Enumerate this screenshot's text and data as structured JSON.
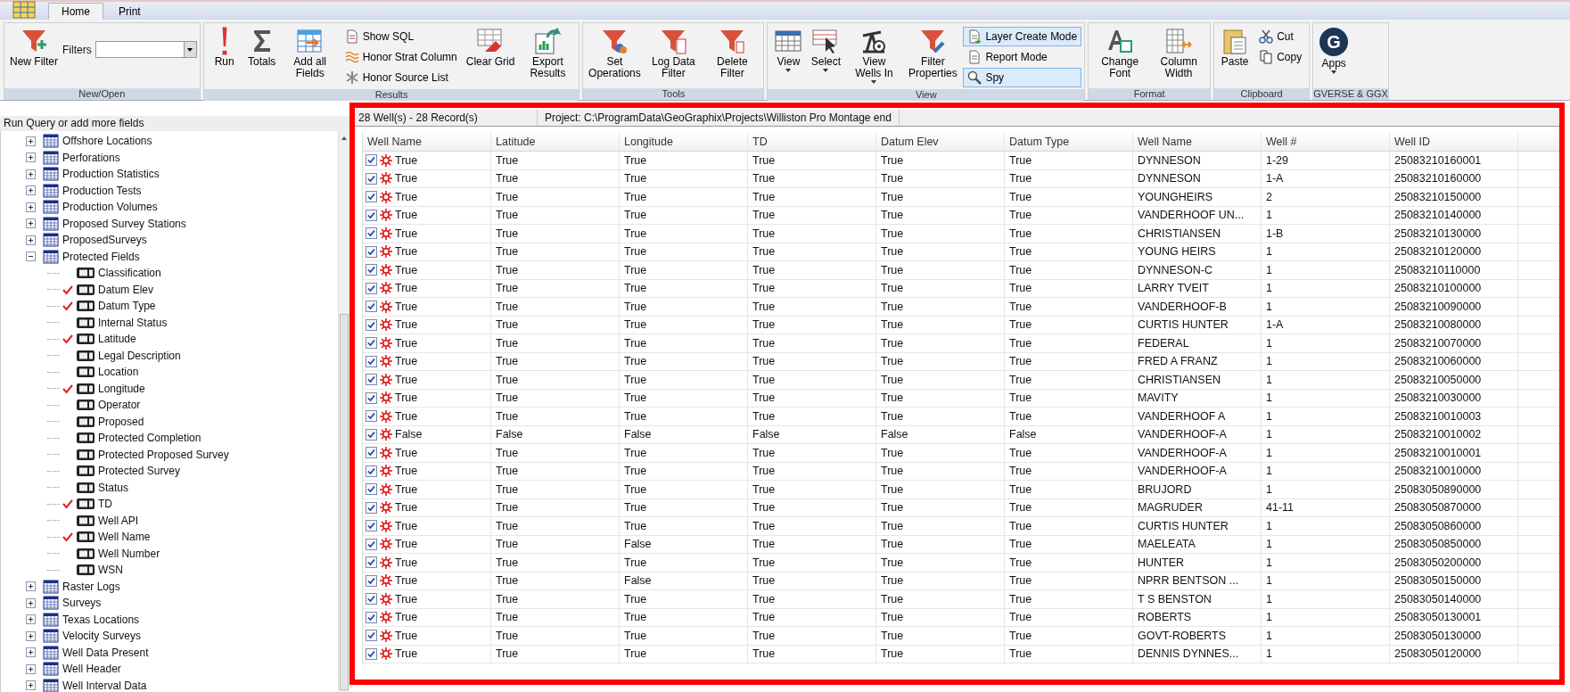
{
  "ribbon": {
    "tabs": [
      {
        "label": "Home",
        "selected": true
      },
      {
        "label": "Print",
        "selected": false
      }
    ],
    "groups": [
      {
        "label": "New/Open",
        "items": [
          {
            "kind": "large",
            "label": "New Filter",
            "dropdown": false
          },
          {
            "kind": "combo",
            "label": "Filters"
          }
        ]
      },
      {
        "label": "Results",
        "items": [
          {
            "kind": "large",
            "label": "Run",
            "dropdown": false
          },
          {
            "kind": "large",
            "label": "Totals",
            "dropdown": false
          },
          {
            "kind": "large",
            "label": "Add all Fields",
            "dropdown": false
          },
          {
            "kind": "stack",
            "items": [
              {
                "label": "Show SQL",
                "selected": false
              },
              {
                "label": "Honor Strat Column",
                "selected": false
              },
              {
                "label": "Honor Source List",
                "selected": false
              }
            ]
          },
          {
            "kind": "large",
            "label": "Clear Grid",
            "dropdown": false
          },
          {
            "kind": "large",
            "label": "Export Results",
            "dropdown": false
          }
        ]
      },
      {
        "label": "Tools",
        "items": [
          {
            "kind": "large",
            "label": "Set Operations",
            "dropdown": false
          },
          {
            "kind": "large",
            "label": "Log Data Filter",
            "dropdown": false
          },
          {
            "kind": "large",
            "label": "Delete Filter",
            "dropdown": false
          }
        ]
      },
      {
        "label": "View",
        "items": [
          {
            "kind": "large",
            "label": "View",
            "dropdown": true
          },
          {
            "kind": "large",
            "label": "Select",
            "dropdown": true
          },
          {
            "kind": "large",
            "label": "View Wells In",
            "dropdown": true
          },
          {
            "kind": "large",
            "label": "Filter Properties",
            "dropdown": false
          },
          {
            "kind": "stack",
            "items": [
              {
                "label": "Layer Create Mode",
                "selected": true
              },
              {
                "label": "Report Mode",
                "selected": false
              },
              {
                "label": "Spy",
                "selected": true
              }
            ]
          }
        ]
      },
      {
        "label": "Format",
        "items": [
          {
            "kind": "large",
            "label": "Change Font",
            "dropdown": false
          },
          {
            "kind": "large",
            "label": "Column Width",
            "dropdown": false
          }
        ]
      },
      {
        "label": "Clipboard",
        "items": [
          {
            "kind": "large",
            "label": "Paste",
            "dropdown": false
          },
          {
            "kind": "stack",
            "items": [
              {
                "label": "Cut",
                "selected": false
              },
              {
                "label": "Copy",
                "selected": false
              }
            ]
          }
        ]
      },
      {
        "label": "GVERSE & GGX",
        "items": [
          {
            "kind": "logo",
            "logo_letter": "G",
            "label": "Apps",
            "dropdown": true
          }
        ]
      }
    ]
  },
  "query_panel": {
    "header": "Run Query or add more fields",
    "tree": [
      {
        "label": "Offshore Locations",
        "expanded": false
      },
      {
        "label": "Perforations",
        "expanded": false
      },
      {
        "label": "Production Statistics",
        "expanded": false
      },
      {
        "label": "Production Tests",
        "expanded": false
      },
      {
        "label": "Production Volumes",
        "expanded": false
      },
      {
        "label": "Proposed Survey Stations",
        "expanded": false
      },
      {
        "label": "ProposedSurveys",
        "expanded": false
      },
      {
        "label": "Protected Fields",
        "expanded": true,
        "children": [
          {
            "label": "Classification",
            "checked": false
          },
          {
            "label": "Datum Elev",
            "checked": true
          },
          {
            "label": "Datum Type",
            "checked": true
          },
          {
            "label": "Internal Status",
            "checked": false
          },
          {
            "label": "Latitude",
            "checked": true
          },
          {
            "label": "Legal Description",
            "checked": false
          },
          {
            "label": "Location",
            "checked": false
          },
          {
            "label": "Longitude",
            "checked": true
          },
          {
            "label": "Operator",
            "checked": false
          },
          {
            "label": "Proposed",
            "checked": false
          },
          {
            "label": "Protected Completion",
            "checked": false
          },
          {
            "label": "Protected Proposed Survey",
            "checked": false
          },
          {
            "label": "Protected Survey",
            "checked": false
          },
          {
            "label": "Status",
            "checked": false
          },
          {
            "label": "TD",
            "checked": true
          },
          {
            "label": "Well API",
            "checked": false
          },
          {
            "label": "Well Name",
            "checked": true
          },
          {
            "label": "Well Number",
            "checked": false
          },
          {
            "label": "WSN",
            "checked": false
          }
        ]
      },
      {
        "label": "Raster Logs",
        "expanded": false
      },
      {
        "label": "Surveys",
        "expanded": false
      },
      {
        "label": "Texas Locations",
        "expanded": false
      },
      {
        "label": "Velocity Surveys",
        "expanded": false
      },
      {
        "label": "Well Data Present",
        "expanded": false
      },
      {
        "label": "Well Header",
        "expanded": false
      },
      {
        "label": "Well Interval Data",
        "expanded": false
      }
    ]
  },
  "results": {
    "record_count": "28 Well(s) - 28 Record(s)",
    "project": "Project:  C:\\ProgramData\\GeoGraphix\\Projects\\Williston Pro Montage end",
    "columns": [
      "Well Name",
      "Latitude",
      "Longitude",
      "TD",
      "Datum Elev",
      "Datum Type",
      "Well Name",
      "Well #",
      "Well ID"
    ],
    "rows": [
      {
        "checked": true,
        "cells": [
          "True",
          "True",
          "True",
          "True",
          "True",
          "True",
          "DYNNESON",
          "1-29",
          "25083210160001"
        ]
      },
      {
        "checked": true,
        "cells": [
          "True",
          "True",
          "True",
          "True",
          "True",
          "True",
          "DYNNESON",
          "1-A",
          "25083210160000"
        ]
      },
      {
        "checked": true,
        "cells": [
          "True",
          "True",
          "True",
          "True",
          "True",
          "True",
          "YOUNGHEIRS",
          "2",
          "25083210150000"
        ]
      },
      {
        "checked": true,
        "cells": [
          "True",
          "True",
          "True",
          "True",
          "True",
          "True",
          "VANDERHOOF UN...",
          "1",
          "25083210140000"
        ]
      },
      {
        "checked": true,
        "cells": [
          "True",
          "True",
          "True",
          "True",
          "True",
          "True",
          "CHRISTIANSEN",
          "1-B",
          "25083210130000"
        ]
      },
      {
        "checked": true,
        "cells": [
          "True",
          "True",
          "True",
          "True",
          "True",
          "True",
          "YOUNG HEIRS",
          "1",
          "25083210120000"
        ]
      },
      {
        "checked": true,
        "cells": [
          "True",
          "True",
          "True",
          "True",
          "True",
          "True",
          "DYNNESON-C",
          "1",
          "25083210110000"
        ]
      },
      {
        "checked": true,
        "cells": [
          "True",
          "True",
          "True",
          "True",
          "True",
          "True",
          "LARRY TVEIT",
          "1",
          "25083210100000"
        ]
      },
      {
        "checked": true,
        "cells": [
          "True",
          "True",
          "True",
          "True",
          "True",
          "True",
          "VANDERHOOF-B",
          "1",
          "25083210090000"
        ]
      },
      {
        "checked": true,
        "cells": [
          "True",
          "True",
          "True",
          "True",
          "True",
          "True",
          "CURTIS HUNTER",
          "1-A",
          "25083210080000"
        ]
      },
      {
        "checked": true,
        "cells": [
          "True",
          "True",
          "True",
          "True",
          "True",
          "True",
          "FEDERAL",
          "1",
          "25083210070000"
        ]
      },
      {
        "checked": true,
        "cells": [
          "True",
          "True",
          "True",
          "True",
          "True",
          "True",
          "FRED A FRANZ",
          "1",
          "25083210060000"
        ]
      },
      {
        "checked": true,
        "cells": [
          "True",
          "True",
          "True",
          "True",
          "True",
          "True",
          "CHRISTIANSEN",
          "1",
          "25083210050000"
        ]
      },
      {
        "checked": true,
        "cells": [
          "True",
          "True",
          "True",
          "True",
          "True",
          "True",
          "MAVITY",
          "1",
          "25083210030000"
        ]
      },
      {
        "checked": true,
        "cells": [
          "True",
          "True",
          "True",
          "True",
          "True",
          "True",
          "VANDERHOOF A",
          "1",
          "25083210010003"
        ]
      },
      {
        "checked": true,
        "cells": [
          "False",
          "False",
          "False",
          "False",
          "False",
          "False",
          "VANDERHOOF-A",
          "1",
          "25083210010002"
        ]
      },
      {
        "checked": true,
        "cells": [
          "True",
          "True",
          "True",
          "True",
          "True",
          "True",
          "VANDERHOOF-A",
          "1",
          "25083210010001"
        ]
      },
      {
        "checked": true,
        "cells": [
          "True",
          "True",
          "True",
          "True",
          "True",
          "True",
          "VANDERHOOF-A",
          "1",
          "25083210010000"
        ]
      },
      {
        "checked": true,
        "cells": [
          "True",
          "True",
          "True",
          "True",
          "True",
          "True",
          "BRUJORD",
          "1",
          "25083050890000"
        ]
      },
      {
        "checked": true,
        "cells": [
          "True",
          "True",
          "True",
          "True",
          "True",
          "True",
          "MAGRUDER",
          "41-11",
          "25083050870000"
        ]
      },
      {
        "checked": true,
        "cells": [
          "True",
          "True",
          "True",
          "True",
          "True",
          "True",
          "CURTIS HUNTER",
          "1",
          "25083050860000"
        ]
      },
      {
        "checked": true,
        "cells": [
          "True",
          "True",
          "False",
          "True",
          "True",
          "True",
          "MAELEATA",
          "1",
          "25083050850000"
        ]
      },
      {
        "checked": true,
        "cells": [
          "True",
          "True",
          "True",
          "True",
          "True",
          "True",
          "HUNTER",
          "1",
          "25083050200000"
        ]
      },
      {
        "checked": true,
        "cells": [
          "True",
          "True",
          "False",
          "True",
          "True",
          "True",
          "NPRR BENTSON ...",
          "1",
          "25083050150000"
        ]
      },
      {
        "checked": true,
        "cells": [
          "True",
          "True",
          "True",
          "True",
          "True",
          "True",
          "T S BENSTON",
          "1",
          "25083050140000"
        ]
      },
      {
        "checked": true,
        "cells": [
          "True",
          "True",
          "True",
          "True",
          "True",
          "True",
          "ROBERTS",
          "1",
          "25083050130001"
        ]
      },
      {
        "checked": true,
        "cells": [
          "True",
          "True",
          "True",
          "True",
          "True",
          "True",
          "GOVT-ROBERTS",
          "1",
          "25083050130000"
        ]
      },
      {
        "checked": true,
        "cells": [
          "True",
          "True",
          "True",
          "True",
          "True",
          "True",
          "DENNIS DYNNES...",
          "1",
          "25083050120000"
        ]
      }
    ]
  }
}
